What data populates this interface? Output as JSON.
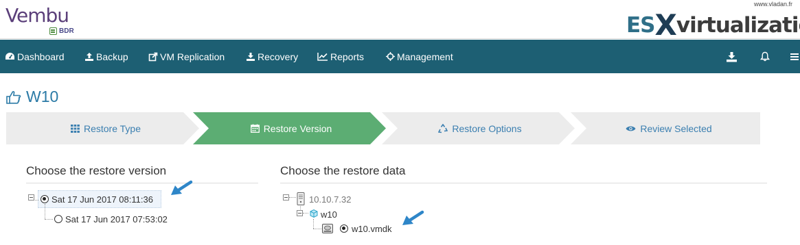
{
  "brand": {
    "name": "Vembu",
    "product": "BDR"
  },
  "watermark": {
    "domain": "www.vladan.fr",
    "prefix": "ES",
    "x": "X",
    "suffix": "virtualization"
  },
  "nav": {
    "items": [
      {
        "label": "Dashboard",
        "icon": "dashboard-icon"
      },
      {
        "label": "Backup",
        "icon": "upload-icon"
      },
      {
        "label": "VM Replication",
        "icon": "replication-icon"
      },
      {
        "label": "Recovery",
        "icon": "download-icon"
      },
      {
        "label": "Reports",
        "icon": "chart-icon"
      },
      {
        "label": "Management",
        "icon": "crosshair-icon"
      }
    ],
    "right_icons": [
      "download-icon",
      "bell-icon",
      "menu-icon"
    ]
  },
  "page": {
    "title": "W10",
    "title_icon": "hand-pointer-icon"
  },
  "wizard": {
    "steps": [
      {
        "label": "Restore Type",
        "icon": "grid-icon",
        "active": false
      },
      {
        "label": "Restore Version",
        "icon": "calendar-icon",
        "active": true
      },
      {
        "label": "Restore Options",
        "icon": "recycle-icon",
        "active": false
      },
      {
        "label": "Review Selected",
        "icon": "eye-icon",
        "active": false
      }
    ],
    "colors": {
      "active": "#5cad73",
      "inactive": "#ececec"
    }
  },
  "version_panel": {
    "title": "Choose the restore version",
    "versions": [
      {
        "label": "Sat 17 Jun 2017 08:11:36",
        "selected": true
      },
      {
        "label": "Sat 17 Jun 2017 07:53:02",
        "selected": false
      }
    ]
  },
  "data_panel": {
    "title": "Choose the restore data",
    "host": {
      "label": "10.10.7.32",
      "icon": "server-icon"
    },
    "vm": {
      "label": "w10",
      "icon": "vm-cube-icon"
    },
    "disk": {
      "label": "w10.vmdk",
      "icon": "disk-icon",
      "selected": true
    }
  },
  "colors": {
    "navbar": "#1d5f73",
    "accent": "#2b7aa6",
    "annotation_arrow": "#2e86c8"
  }
}
